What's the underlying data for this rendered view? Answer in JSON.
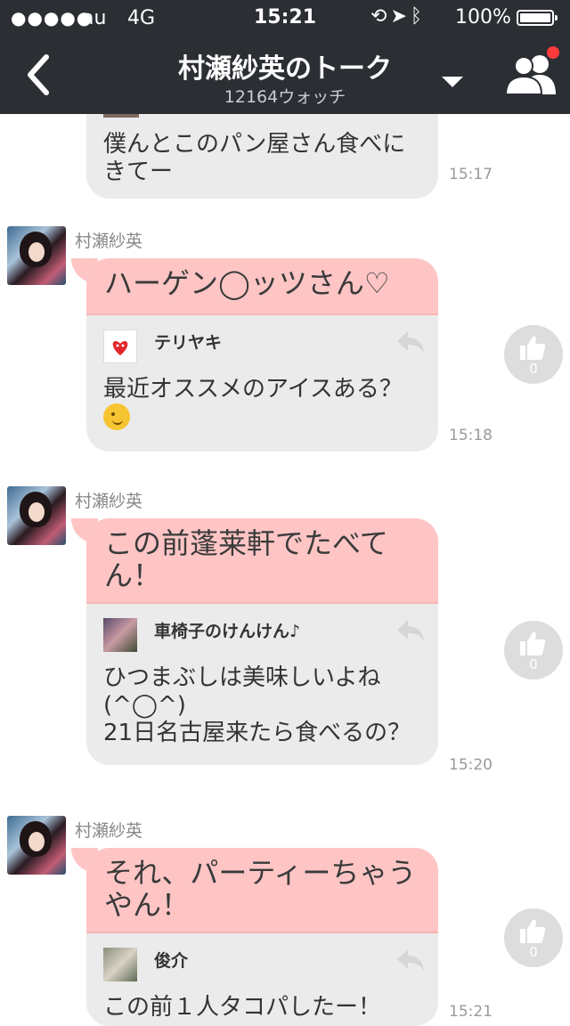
{
  "status_bar": {
    "signal": "●●●●●",
    "carrier": "au",
    "network": "4G",
    "time": "15:21",
    "battery": "100%"
  },
  "header": {
    "title": "村瀬紗英のトーク",
    "watch_count": "12164ウォッチ"
  },
  "partial_top": {
    "text": "僕んとこのパン屋さん食べにきてー",
    "time": "15:17"
  },
  "messages": [
    {
      "sender": "村瀬紗英",
      "text": "ハーゲン◯ッツさん♡",
      "reply_name": "テリヤキ",
      "reply_text": "最近オススメのアイスある？",
      "time": "15:18",
      "like_count": "0"
    },
    {
      "sender": "村瀬紗英",
      "text": "この前蓬莱軒でたべてん！",
      "reply_name": "車椅子のけんけん♪",
      "reply_text": "ひつまぶしは美味しいよね(^◯^)\n21日名古屋来たら食べるの？",
      "time": "15:20",
      "like_count": "0"
    },
    {
      "sender": "村瀬紗英",
      "text": "それ、パーティーちゃうやん！",
      "reply_name": "俊介",
      "reply_text": "この前１人タコパしたー！",
      "time": "15:21",
      "like_count": "0"
    }
  ]
}
